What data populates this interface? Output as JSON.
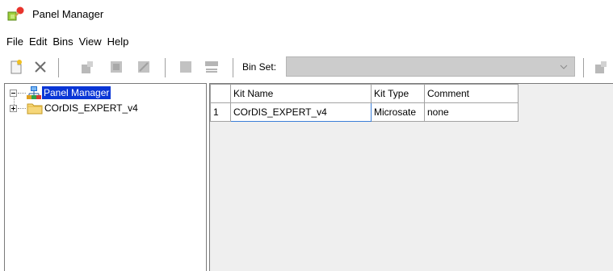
{
  "window": {
    "title": "Panel Manager"
  },
  "menu": [
    "File",
    "Edit",
    "Bins",
    "View",
    "Help"
  ],
  "toolbar": {
    "binset_label": "Bin Set:",
    "binset_value": ""
  },
  "tree": {
    "root_label": "Panel Manager",
    "children": [
      {
        "label": "COrDIS_EXPERT_v4"
      }
    ]
  },
  "grid": {
    "columns": [
      "Kit Name",
      "Kit Type",
      "Comment"
    ],
    "rows": [
      {
        "index": "1",
        "kit_name": "COrDIS_EXPERT_v4",
        "kit_type": "Microsate",
        "comment": "none"
      }
    ]
  },
  "colors": {
    "selection": "#0a36d6",
    "combo_bg": "#cccccc",
    "grid_bg": "#efefef"
  }
}
